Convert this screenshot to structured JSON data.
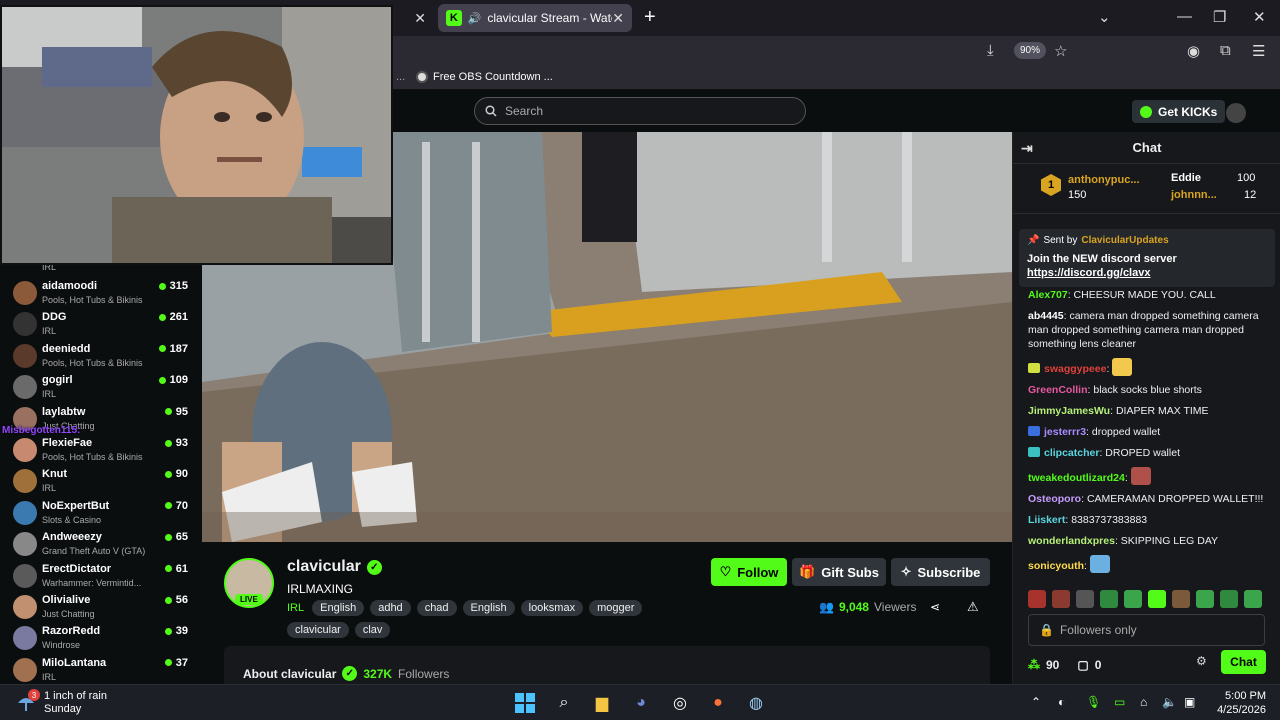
{
  "browser": {
    "active_tab_title": "clavicular Stream - Watch L",
    "zoom": "90%",
    "bookmark": "Free OBS Countdown ...",
    "bookmark_more": "..."
  },
  "header": {
    "search_placeholder": "Search",
    "get_kicks": "Get KICKs"
  },
  "sidebar": {
    "top_cat": "IRL",
    "items": [
      {
        "name": "aidamoodi",
        "category": "Pools, Hot Tubs & Bikinis",
        "viewers": "315"
      },
      {
        "name": "DDG",
        "category": "IRL",
        "viewers": "261"
      },
      {
        "name": "deeniedd",
        "category": "Pools, Hot Tubs & Bikinis",
        "viewers": "187"
      },
      {
        "name": "gogirl",
        "category": "IRL",
        "viewers": "109"
      },
      {
        "name": "laylabtw",
        "category": "Just Chatting",
        "viewers": "95"
      },
      {
        "name": "FlexieFae",
        "category": "Pools, Hot Tubs & Bikinis",
        "viewers": "93"
      },
      {
        "name": "Knut",
        "category": "IRL",
        "viewers": "90"
      },
      {
        "name": "NoExpertBut",
        "category": "Slots & Casino",
        "viewers": "70"
      },
      {
        "name": "Andweeezy",
        "category": "Grand Theft Auto V (GTA)",
        "viewers": "65"
      },
      {
        "name": "ErectDictator",
        "category": "Warhammer: Vermintid...",
        "viewers": "61"
      },
      {
        "name": "Olivialive",
        "category": "Just Chatting",
        "viewers": "56"
      },
      {
        "name": "RazorRedd",
        "category": "Windrose",
        "viewers": "39"
      },
      {
        "name": "MiloLantana",
        "category": "IRL",
        "viewers": "37"
      }
    ],
    "overlay_name": "Misbegotten115:"
  },
  "channel": {
    "name": "clavicular",
    "live": "LIVE",
    "title": "IRLMAXING",
    "category": "IRL",
    "tags": [
      "English",
      "adhd",
      "chad",
      "English",
      "looksmax",
      "mogger",
      "clavicular",
      "clav"
    ],
    "follow": "Follow",
    "gift_subs": "Gift Subs",
    "subscribe": "Subscribe",
    "viewers_count": "9,048",
    "viewers_label": "Viewers",
    "about_title": "About clavicular",
    "followers_count": "327K",
    "followers_label": "Followers"
  },
  "chat": {
    "title": "Chat",
    "gifters": [
      {
        "rank": "1",
        "name": "anthonypuc...",
        "value": "150"
      },
      {
        "name": "Eddie",
        "value": "100"
      },
      {
        "name": "johnnn...",
        "value": "12"
      }
    ],
    "pinned_sent_by": "Sent by",
    "pinned_user": "ClavicularUpdates",
    "pinned_message": "Join the NEW discord server",
    "pinned_link": "https://discord.gg/clavx",
    "messages": [
      {
        "user": "Alex707",
        "color": "#53fc18",
        "text": "CHEESUR MADE YOU. CALL"
      },
      {
        "user": "ab4445",
        "color": "#ffffff",
        "text": "camera man dropped something camera man dropped something camera man dropped something lens cleaner"
      },
      {
        "user": "swaggypeee",
        "color": "#e0413c",
        "text": ""
      },
      {
        "user": "GreenCollin",
        "color": "#e85aa0",
        "text": "black socks blue shorts"
      },
      {
        "user": "JimmyJamesWu",
        "color": "#b6f078",
        "text": "DIAPER MAX TIME"
      },
      {
        "user": "jesterrr3",
        "color": "#a98cff",
        "text": "dropped wallet"
      },
      {
        "user": "clipcatcher",
        "color": "#5ad6e0",
        "text": "DROPED wallet"
      },
      {
        "user": "tweakedoutlizard24",
        "color": "#53fc18",
        "text": ""
      },
      {
        "user": "Osteoporo",
        "color": "#c79cff",
        "text": "CAMERAMAN DROPPED WALLET!!!"
      },
      {
        "user": "Liiskert",
        "color": "#5ad6e0",
        "text": "8383737383883"
      },
      {
        "user": "wonderlandxpres",
        "color": "#b6f078",
        "text": "SKIPPING LEG DAY"
      },
      {
        "user": "sonicyouth",
        "color": "#ffdb4a",
        "text": ""
      }
    ],
    "input_placeholder": "Followers only",
    "points": "90",
    "zero": "0",
    "send": "Chat"
  },
  "taskbar": {
    "weather_badge": "3",
    "weather_line1": "1 inch of rain",
    "weather_line2": "Sunday",
    "time": "5:00 PM",
    "date": "4/25/2026"
  }
}
